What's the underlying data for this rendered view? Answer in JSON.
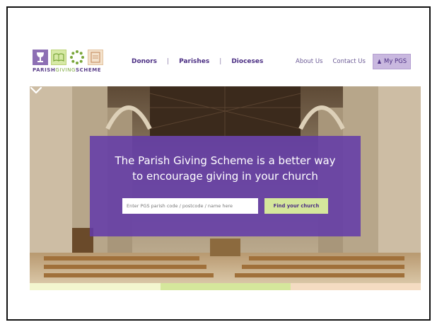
{
  "logo": {
    "text_parish": "PARISH",
    "text_giving": "GIVING",
    "text_scheme": "SCHEME",
    "icons": [
      "chalice-icon",
      "open-book-icon",
      "circle-of-dots-icon",
      "document-icon"
    ]
  },
  "nav": {
    "main": [
      {
        "label": "Donors"
      },
      {
        "label": "Parishes"
      },
      {
        "label": "Dioceses"
      }
    ],
    "separator": "|",
    "about": "About Us",
    "contact": "Contact Us",
    "mypgs": "My PGS",
    "mypgs_icon": "user-icon"
  },
  "hero": {
    "headline_line1": "The Parish Giving Scheme is a better way",
    "headline_line2": "to encourage giving in your church",
    "search_placeholder": "Enter PGS parish code / postcode / name here",
    "button_label": "Find your church",
    "scroll_icon": "chevron-down-icon"
  },
  "colors": {
    "purple": "#623aaa",
    "green": "#d5e79c",
    "peach": "#f4dcc2",
    "pale_yellow": "#f3f6cf"
  }
}
